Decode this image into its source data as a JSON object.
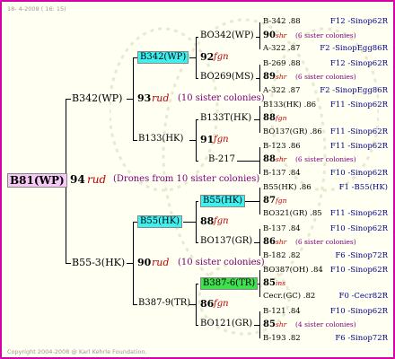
{
  "header": {
    "date_text": "18-  4-2008 ( 16: 15)"
  },
  "footer": {
    "copyright": "Copyright 2004-2008 @ Karl Kehrle Foundation."
  },
  "root": {
    "id": "B81(WP)",
    "year": "94",
    "mark": "rud",
    "note": "(Drones from 10 sister colonies)"
  },
  "gen1": [
    {
      "id": "B342(WP)",
      "year": "93",
      "mark": "rud",
      "note": "(10 sister colonies)"
    },
    {
      "id": "B55-3(HK)",
      "year": "90",
      "mark": "rud",
      "note": "(10 sister colonies)"
    }
  ],
  "gen2": [
    {
      "id": "B342(WP)"
    },
    {
      "id": "B133(HK)"
    },
    {
      "id": "B55(HK)"
    },
    {
      "id": "B387-9(TR)"
    }
  ],
  "gen3": [
    {
      "id": "BO342(WP)",
      "year": "92",
      "mark": "fgn"
    },
    {
      "id": "BO269(MS)"
    },
    {
      "id": "B133T(HK)",
      "year": "91",
      "mark": "fgn"
    },
    {
      "id": "B-217"
    },
    {
      "id": "B55(HK)",
      "year": "88",
      "mark": "fgn"
    },
    {
      "id": "BO137(GR)"
    },
    {
      "id": "B387-6(TR)",
      "year": "86",
      "mark": "fgn"
    },
    {
      "id": "BO121(GR)"
    }
  ],
  "gen4": [
    {
      "top": "B-342 .88",
      "top_r": "F12 -Sinop62R",
      "year": "90",
      "mark": "shr",
      "note": "(6 sister colonies)",
      "bot": "A-322 .87",
      "bot_r": "F2 -SinopEgg86R"
    },
    {
      "top": "B-269 .88",
      "top_r": "F12 -Sinop62R",
      "year": "89",
      "mark": "shr",
      "note": "(6 sister colonies)",
      "bot": "A-322 .87",
      "bot_r": "F2 -SinopEgg86R"
    },
    {
      "top": "B133(HK) .86",
      "top_r": "F11 -Sinop62R",
      "year": "88",
      "mark": "fgn",
      "note": "",
      "bot": "BO137(GR) .86",
      "bot_r": "F11 -Sinop62R"
    },
    {
      "top": "B-123 .86",
      "top_r": "F11 -Sinop62R",
      "year": "88",
      "mark": "shr",
      "note": "(6 sister colonies)",
      "bot": "B-137 .84",
      "bot_r": "F10 -Sinop62R"
    },
    {
      "top": "B55(HK) .86",
      "top_r": "F1 -B55(HK)",
      "year": "87",
      "mark": "fgn",
      "note": "",
      "bot": "BO321(GR) .85",
      "bot_r": "F11 -Sinop62R"
    },
    {
      "top": "B-137 .84",
      "top_r": "F10 -Sinop62R",
      "year": "86",
      "mark": "shr",
      "note": "(6 sister colonies)",
      "bot": "B-182 .82",
      "bot_r": "F6 -Sinop72R"
    },
    {
      "top": "BO387(OH) .84",
      "top_r": "F10 -Sinop62R",
      "year": "85",
      "mark": "ins",
      "note": "",
      "bot": "Cecr.(GC) .82",
      "bot_r": "F0 -Cecr82R"
    },
    {
      "top": "B-121 .84",
      "top_r": "F10 -Sinop62R",
      "year": "85",
      "mark": "shr",
      "note": "(4 sister colonies)",
      "bot": "B-193 .82",
      "bot_r": "F6 -Sinop72R"
    }
  ]
}
